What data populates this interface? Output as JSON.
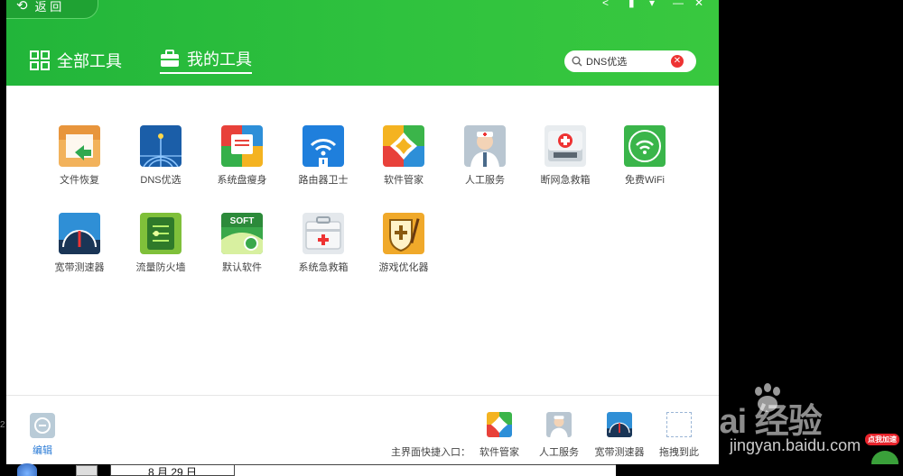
{
  "window": {
    "back_label": "返 回",
    "controls": [
      "share-icon",
      "skin-icon",
      "menu-icon",
      "minimize-icon",
      "close-icon"
    ]
  },
  "tabs": [
    {
      "label": "全部工具",
      "icon": "grid-icon",
      "active": false
    },
    {
      "label": "我的工具",
      "icon": "toolbox-icon",
      "active": true
    }
  ],
  "search": {
    "value": "DNS优选",
    "placeholder": ""
  },
  "tools": [
    {
      "label": "文件恢复",
      "icon": "file-recovery-icon"
    },
    {
      "label": "DNS优选",
      "icon": "dns-globe-icon"
    },
    {
      "label": "系统盘瘦身",
      "icon": "disk-slim-icon"
    },
    {
      "label": "路由器卫士",
      "icon": "router-guard-icon"
    },
    {
      "label": "软件管家",
      "icon": "software-manager-icon"
    },
    {
      "label": "人工服务",
      "icon": "doctor-icon"
    },
    {
      "label": "断网急救箱",
      "icon": "network-firstaid-icon"
    },
    {
      "label": "免费WiFi",
      "icon": "wifi-icon"
    },
    {
      "label": "宽带测速器",
      "icon": "speedometer-icon"
    },
    {
      "label": "流量防火墙",
      "icon": "traffic-firewall-icon"
    },
    {
      "label": "默认软件",
      "icon": "default-software-icon"
    },
    {
      "label": "系统急救箱",
      "icon": "system-firstaid-icon"
    },
    {
      "label": "游戏优化器",
      "icon": "game-optimizer-icon"
    }
  ],
  "bottom": {
    "edit_label": "编辑",
    "quick_label": "主界面快捷入口：",
    "quick_items": [
      {
        "label": "软件管家",
        "icon": "software-manager-icon"
      },
      {
        "label": "人工服务",
        "icon": "doctor-icon"
      },
      {
        "label": "宽带测速器",
        "icon": "speedometer-icon"
      },
      {
        "label": "拖拽到此",
        "icon": "drop-target-icon"
      }
    ]
  },
  "watermark": {
    "logo_text": "Bai 经验",
    "url_text": "jingyan.baidu.com",
    "badge_text": "点我加速"
  },
  "taskbar": {
    "date_text": "8 月 29 日"
  },
  "colors": {
    "header_green": "#2fc23e",
    "accent_blue": "#2a7bd6",
    "clear_red": "#e33333"
  }
}
